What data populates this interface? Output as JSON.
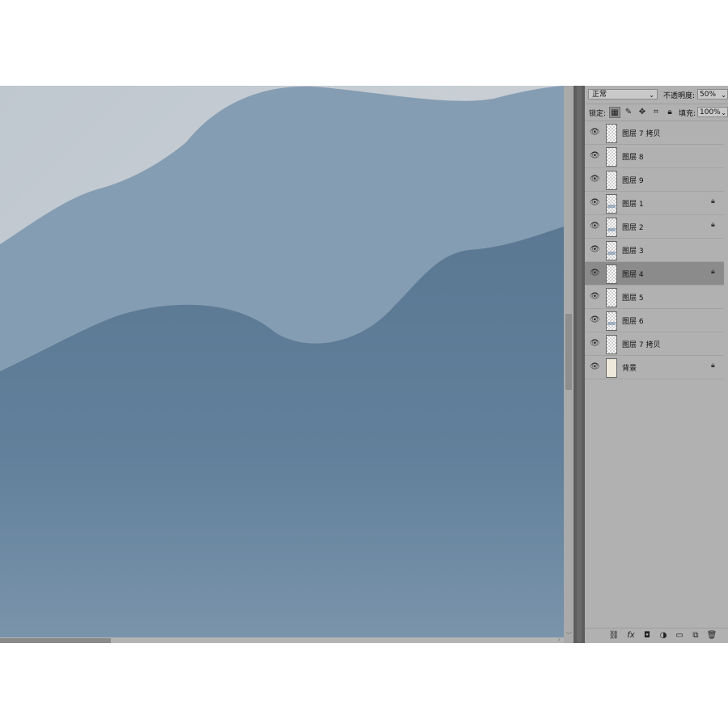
{
  "layers_panel": {
    "blend_mode": "正常",
    "opacity_label": "不透明度:",
    "opacity_value": "50%",
    "lock_label": "锁定:",
    "fill_label": "填充:",
    "fill_value": "100%",
    "layers": [
      {
        "name": "图层 7 拷贝",
        "visible": true,
        "locked": false,
        "selected": false
      },
      {
        "name": "图层 8",
        "visible": true,
        "locked": false,
        "selected": false
      },
      {
        "name": "图层 9",
        "visible": true,
        "locked": false,
        "selected": false
      },
      {
        "name": "图层 1",
        "visible": true,
        "locked": true,
        "selected": false
      },
      {
        "name": "图层 2",
        "visible": true,
        "locked": true,
        "selected": false
      },
      {
        "name": "图层 3",
        "visible": true,
        "locked": false,
        "selected": false
      },
      {
        "name": "图层 4",
        "visible": true,
        "locked": true,
        "selected": true
      },
      {
        "name": "图层 5",
        "visible": true,
        "locked": false,
        "selected": false
      },
      {
        "name": "图层 6",
        "visible": true,
        "locked": false,
        "selected": false
      },
      {
        "name": "图层 7 拷贝",
        "visible": true,
        "locked": false,
        "selected": false
      },
      {
        "name": "背景",
        "visible": true,
        "locked": true,
        "selected": false
      }
    ],
    "bottom_icons": [
      "link-icon",
      "fx-icon",
      "mask-icon",
      "adjustment-icon",
      "folder-icon",
      "new-layer-icon",
      "trash-icon"
    ]
  },
  "canvas": {
    "sky_color": "#c3cad1",
    "mountain_far_color": "#869eb3",
    "mountain_near_color": "#5f7c96",
    "bottom_color": "#7a93aa"
  }
}
